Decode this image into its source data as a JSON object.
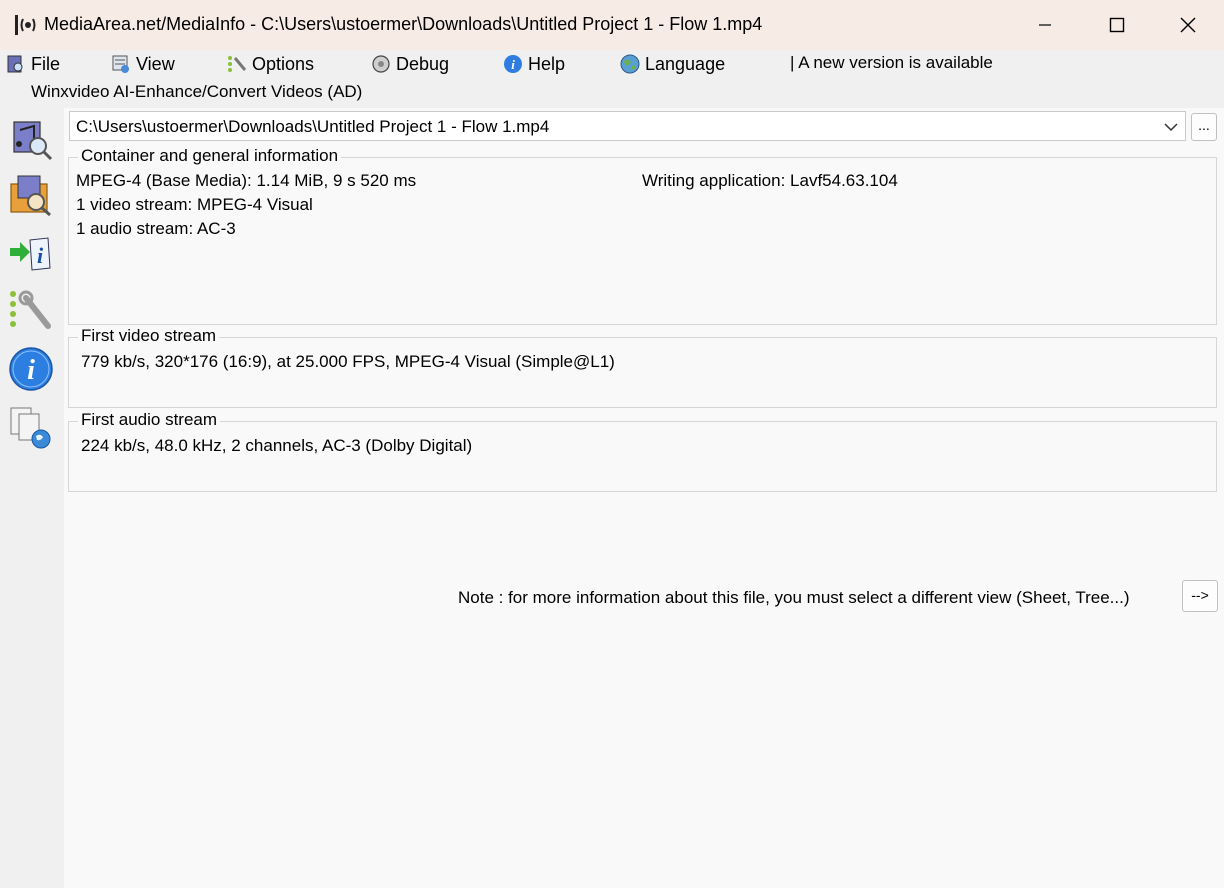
{
  "window": {
    "title": "MediaArea.net/MediaInfo - C:\\Users\\ustoermer\\Downloads\\Untitled Project 1 - Flow 1.mp4"
  },
  "menu": {
    "items": [
      {
        "label": "File",
        "icon": "file-icon"
      },
      {
        "label": "View",
        "icon": "view-icon"
      },
      {
        "label": "Options",
        "icon": "options-icon"
      },
      {
        "label": "Debug",
        "icon": "debug-icon"
      },
      {
        "label": "Help",
        "icon": "help-icon"
      },
      {
        "label": "Language",
        "icon": "language-icon"
      }
    ],
    "new_version": "| A new version is available"
  },
  "ad_text": "Winxvideo AI-Enhance/Convert Videos (AD)",
  "sidebar": {
    "icons": [
      "open-file-icon",
      "open-folder-icon",
      "export-icon",
      "preferences-icon",
      "about-icon",
      "web-icon"
    ]
  },
  "file_select": {
    "value": "C:\\Users\\ustoermer\\Downloads\\Untitled Project 1 - Flow 1.mp4",
    "browse_label": "..."
  },
  "general": {
    "legend": "Container and general information",
    "format": "MPEG-4 (Base Media): 1.14 MiB, 9 s 520 ms",
    "video_count": "1 video stream: MPEG-4 Visual",
    "audio_count": "1 audio stream: AC-3",
    "writing_app": "Writing application: Lavf54.63.104"
  },
  "video": {
    "legend": "First video stream",
    "summary": "779 kb/s, 320*176 (16:9), at 25.000 FPS, MPEG-4 Visual (Simple@L1)"
  },
  "audio": {
    "legend": "First audio stream",
    "summary": "224 kb/s, 48.0 kHz, 2 channels, AC-3 (Dolby Digital)"
  },
  "note": {
    "text": "Note : for more information about this file, you must select a different view (Sheet, Tree...)",
    "button_label": "-->"
  }
}
